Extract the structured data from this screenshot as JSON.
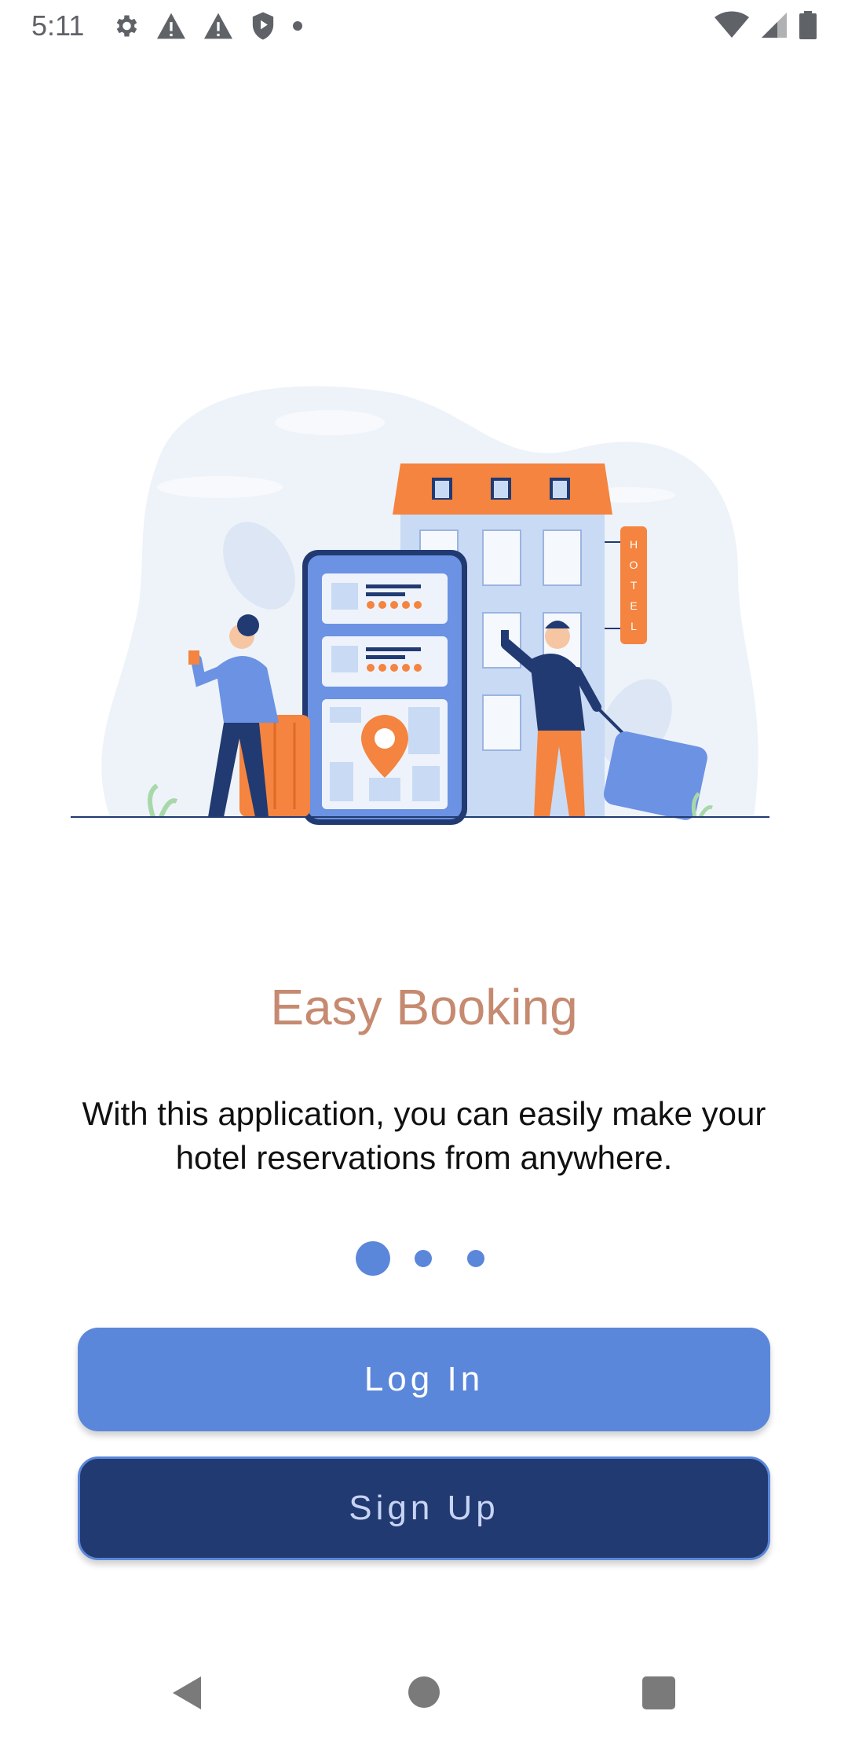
{
  "status_bar": {
    "time": "5:11",
    "left_icons": [
      "gear-icon",
      "warning-icon",
      "warning-icon",
      "shield-icon",
      "dot-icon"
    ],
    "right_icons": [
      "wifi-icon",
      "signal-icon",
      "battery-icon"
    ]
  },
  "illustration": {
    "icon": "hotel-booking-illustration",
    "hotel_sign": [
      "H",
      "O",
      "T",
      "E",
      "L"
    ]
  },
  "onboarding": {
    "title": "Easy Booking",
    "description": "With this application, you can easily make your hotel reservations from anywhere.",
    "page_indicator": {
      "total": 3,
      "active": 1
    }
  },
  "buttons": {
    "login_label": "Log In",
    "signup_label": "Sign Up"
  },
  "colors": {
    "title": "#c58a70",
    "primary": "#5b87db",
    "secondary": "#213a71",
    "accent_orange": "#f4843f"
  },
  "nav_bar": {
    "icons": [
      "back-icon",
      "home-icon",
      "recents-icon"
    ]
  }
}
